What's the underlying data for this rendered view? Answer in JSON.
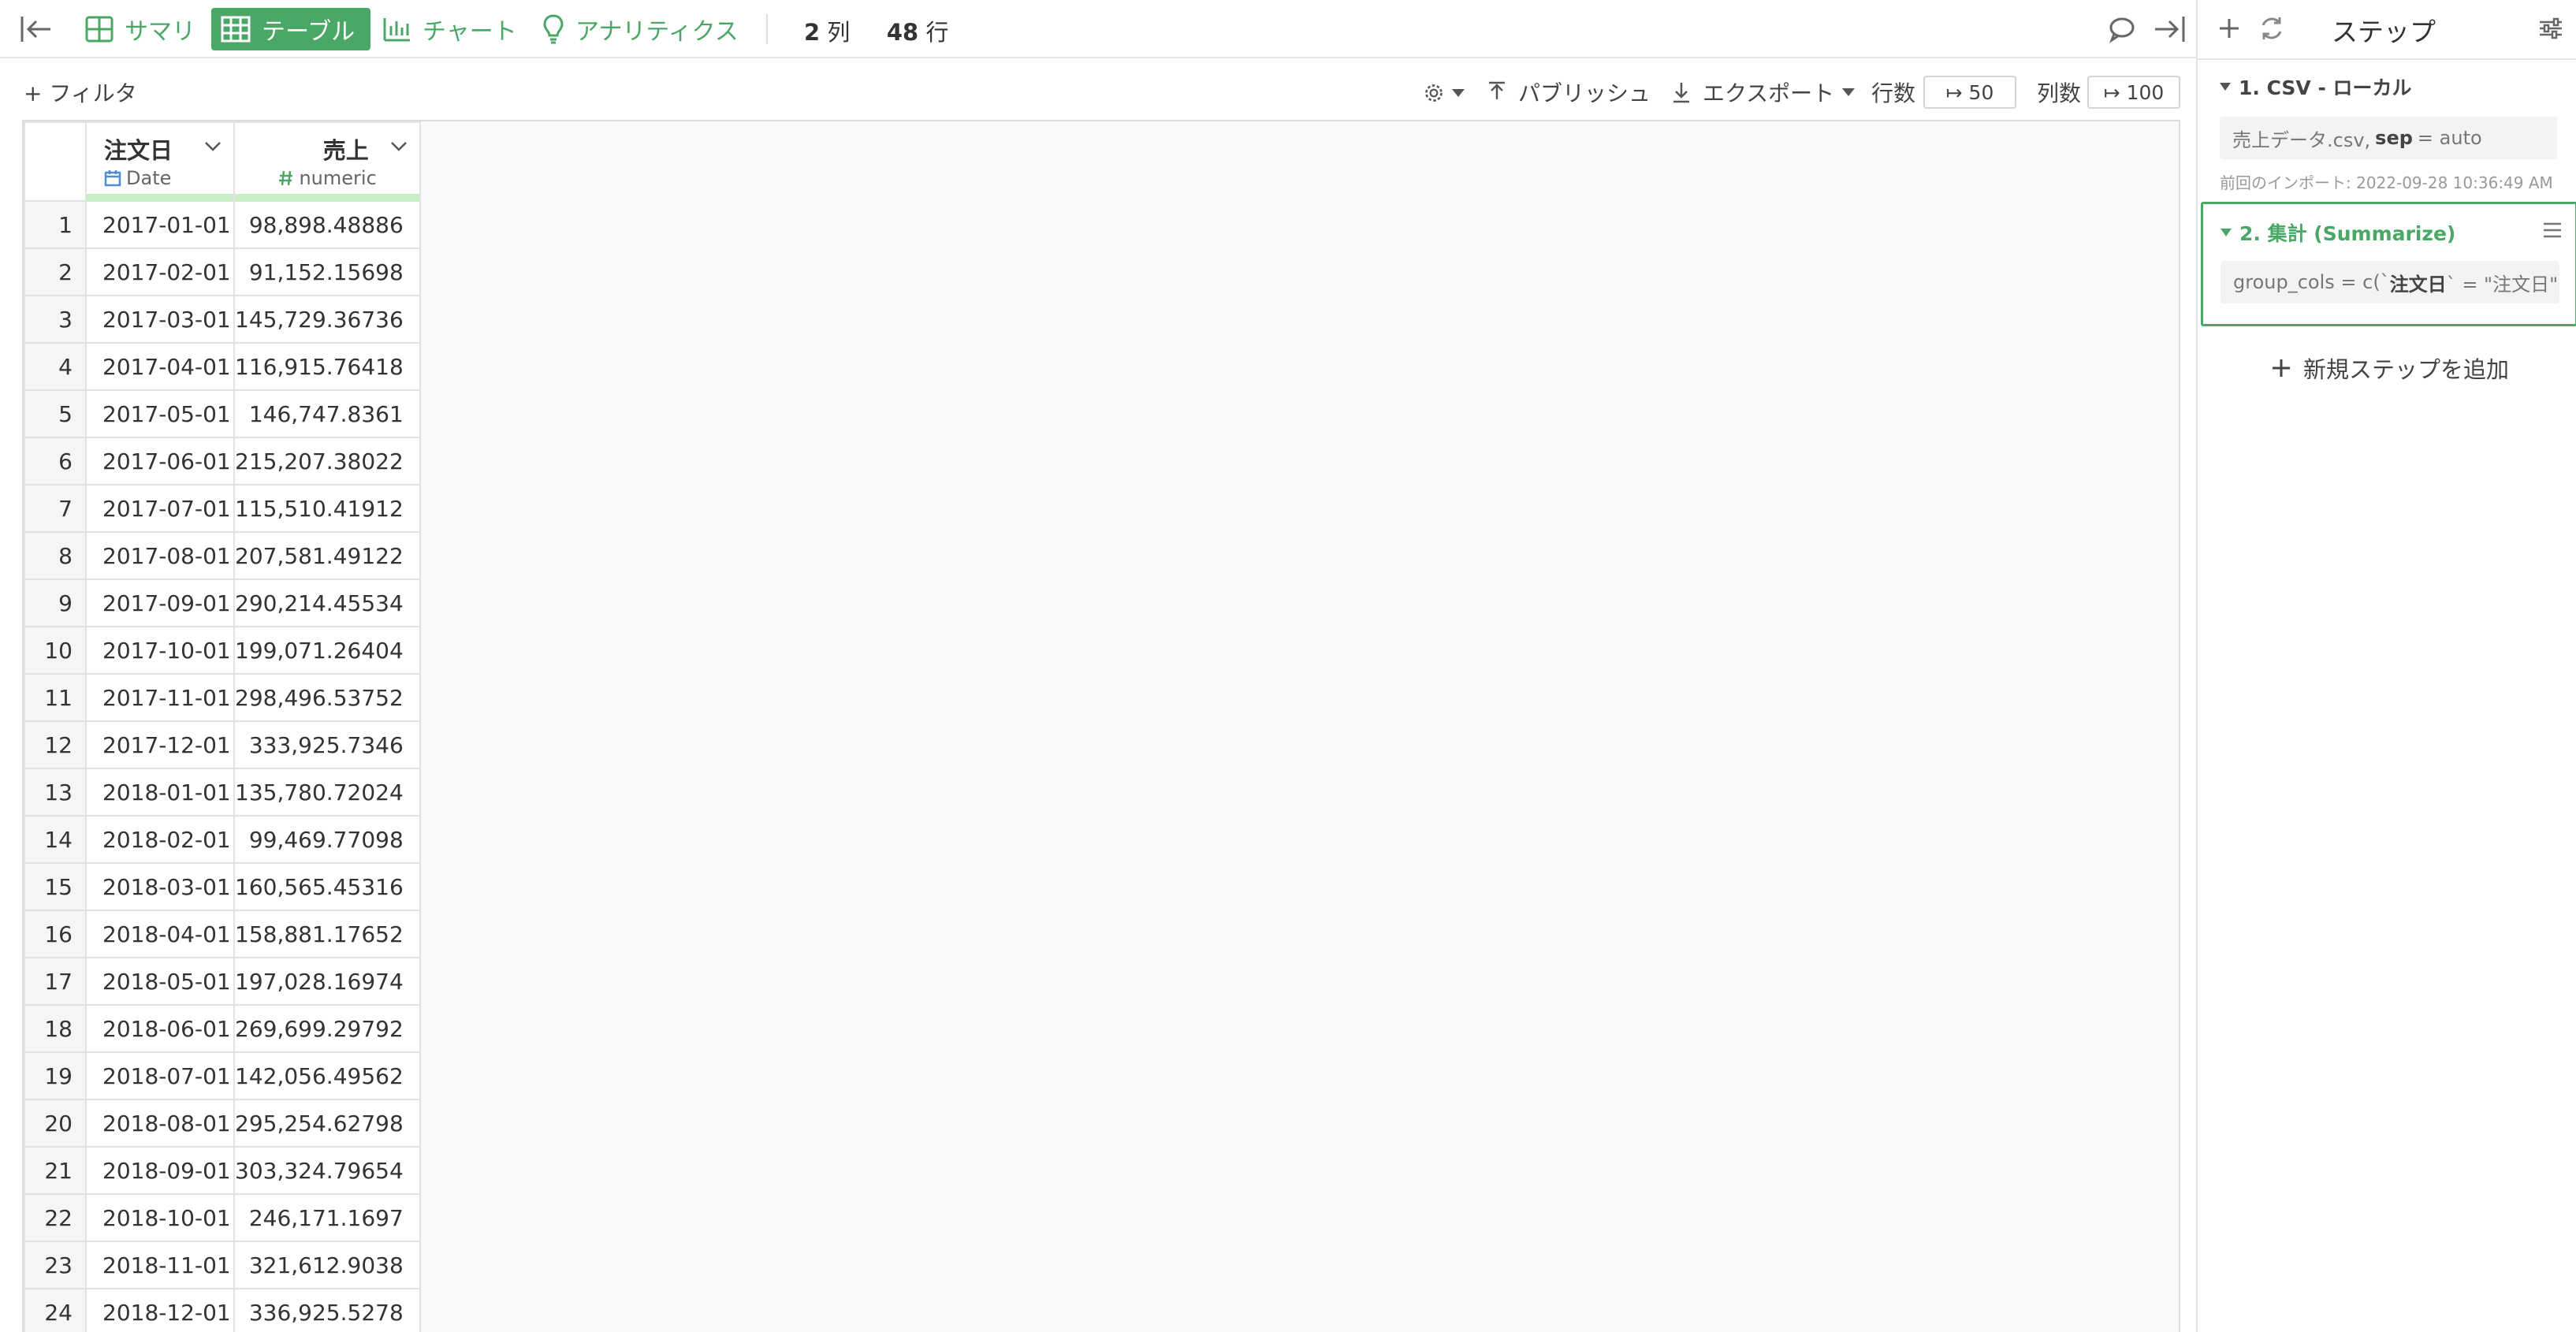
{
  "toolbar": {
    "tabs": [
      {
        "label": "サマリ",
        "icon": "summary-grid-icon"
      },
      {
        "label": "テーブル",
        "icon": "table-icon",
        "active": true
      },
      {
        "label": "チャート",
        "icon": "bar-chart-icon"
      },
      {
        "label": "アナリティクス",
        "icon": "lightbulb-icon"
      }
    ],
    "col_count": "2",
    "col_unit": "列",
    "row_count": "48",
    "row_unit": "行"
  },
  "subtoolbar": {
    "filter_label": "+ フィルタ",
    "publish_label": "パブリッシュ",
    "export_label": "エクスポート",
    "rows_label": "行数",
    "rows_value": "↦ 50",
    "cols_label": "列数",
    "cols_value": "↦ 100"
  },
  "table": {
    "columns": [
      {
        "name": "注文日",
        "type": "Date"
      },
      {
        "name": "売上",
        "type": "numeric"
      }
    ],
    "rows": [
      [
        "1",
        "2017-01-01",
        "98,898.48886"
      ],
      [
        "2",
        "2017-02-01",
        "91,152.15698"
      ],
      [
        "3",
        "2017-03-01",
        "145,729.36736"
      ],
      [
        "4",
        "2017-04-01",
        "116,915.76418"
      ],
      [
        "5",
        "2017-05-01",
        "146,747.8361"
      ],
      [
        "6",
        "2017-06-01",
        "215,207.38022"
      ],
      [
        "7",
        "2017-07-01",
        "115,510.41912"
      ],
      [
        "8",
        "2017-08-01",
        "207,581.49122"
      ],
      [
        "9",
        "2017-09-01",
        "290,214.45534"
      ],
      [
        "10",
        "2017-10-01",
        "199,071.26404"
      ],
      [
        "11",
        "2017-11-01",
        "298,496.53752"
      ],
      [
        "12",
        "2017-12-01",
        "333,925.7346"
      ],
      [
        "13",
        "2018-01-01",
        "135,780.72024"
      ],
      [
        "14",
        "2018-02-01",
        "99,469.77098"
      ],
      [
        "15",
        "2018-03-01",
        "160,565.45316"
      ],
      [
        "16",
        "2018-04-01",
        "158,881.17652"
      ],
      [
        "17",
        "2018-05-01",
        "197,028.16974"
      ],
      [
        "18",
        "2018-06-01",
        "269,699.29792"
      ],
      [
        "19",
        "2018-07-01",
        "142,056.49562"
      ],
      [
        "20",
        "2018-08-01",
        "295,254.62798"
      ],
      [
        "21",
        "2018-09-01",
        "303,324.79654"
      ],
      [
        "22",
        "2018-10-01",
        "246,171.1697"
      ],
      [
        "23",
        "2018-11-01",
        "321,612.9038"
      ],
      [
        "24",
        "2018-12-01",
        "336,925.5278"
      ]
    ]
  },
  "panel": {
    "title": "ステップ",
    "step1": {
      "title": "1. CSV - ローカル",
      "code_file": "売上データ.csv,",
      "code_key": "sep",
      "code_rest": "= auto",
      "meta": "前回のインポート: 2022-09-28 10:36:49 AM"
    },
    "step2": {
      "title": "2. 集計 (Summarize)",
      "code_pre": "group_cols = c(`",
      "code_bold": "注文日",
      "code_post": "` = \"注文日\"),..."
    },
    "add_step_label": "新規ステップを追加"
  },
  "colors": {
    "accent": "#4aa867",
    "date_icon": "#4a8fd8",
    "header_bar": "#c9eec7"
  }
}
